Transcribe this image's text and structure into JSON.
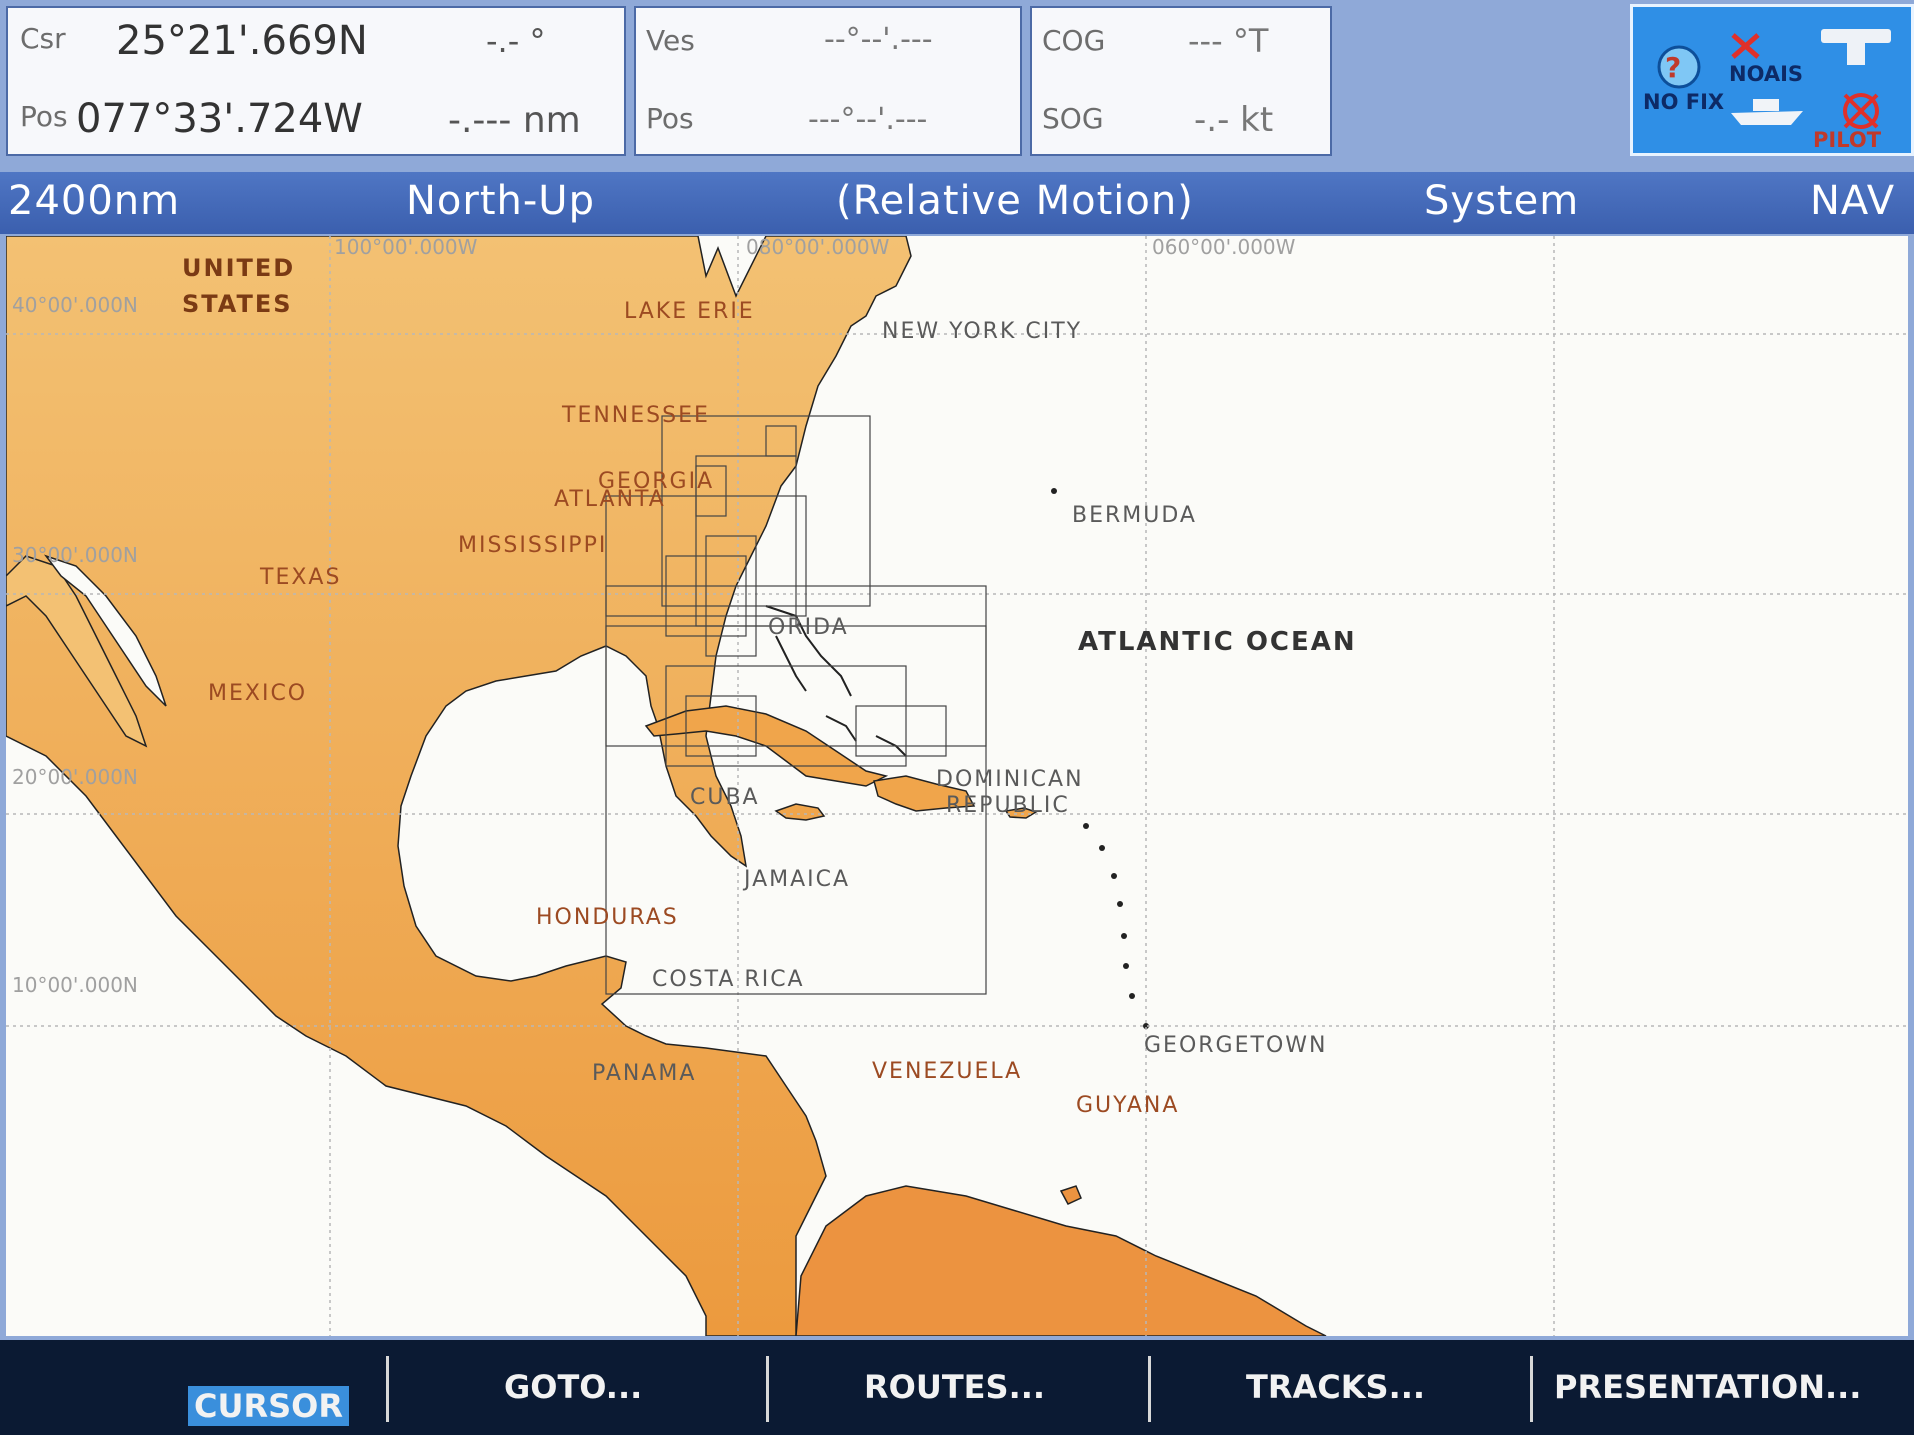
{
  "cursor_panel": {
    "lbl_csr": "Csr",
    "lat": "25°21'.669N",
    "bearing": "-.- °",
    "lbl_pos": "Pos",
    "lon": "077°33'.724W",
    "range": "-.--- nm"
  },
  "vessel_panel": {
    "lbl_ves": "Ves",
    "lat": "--°--'.---",
    "lbl_pos": "Pos",
    "lon": "---°--'.---"
  },
  "course_panel": {
    "lbl_cog": "COG",
    "cog": "--- °T",
    "lbl_sog": "SOG",
    "sog": "-.- kt"
  },
  "status": {
    "no_fix": "NO FIX",
    "no_ais": "NOAIS",
    "pilot": "PILOT"
  },
  "header": {
    "range": "2400nm",
    "orientation": "North-Up",
    "motion": "(Relative Motion)",
    "mode": "System",
    "nav": "NAV"
  },
  "map": {
    "grid": {
      "lon1": "100°00'.000W",
      "lon2": "080°00'.000W",
      "lon3": "060°00'.000W",
      "lat40": "40°00'.000N",
      "lat30": "30°00'.000N",
      "lat20": "20°00'.000N",
      "lat10": "10°00'.000N"
    },
    "labels": {
      "united": "UNITED",
      "states": "STATES",
      "lake_erie": "LAKE ERIE",
      "nyc": "NEW YORK CITY",
      "tennessee": "TENNESSEE",
      "georgia": "GEORGIA",
      "atlanta": "ATLANTA",
      "mississippi": "MISSISSIPPI",
      "texas": "TEXAS",
      "bermuda": "BERMUDA",
      "florida": "ORIDA",
      "atlantic": "ATLANTIC OCEAN",
      "mexico": "MEXICO",
      "cuba": "CUBA",
      "dominican": "DOMINICAN",
      "republic": "REPUBLIC",
      "jamaica": "JAMAICA",
      "honduras": "HONDURAS",
      "costa_rica": "COSTA RICA",
      "georgetown": "GEORGETOWN",
      "venezuela": "VENEZUELA",
      "guyana": "GUYANA",
      "panama": "PANAMA"
    },
    "colors": {
      "land_north": "#efb466",
      "land_south": "#ec9a3e",
      "sea": "#fbfbf8",
      "label": "#9c4a22",
      "label_sea": "#5a5a5a"
    }
  },
  "softkeys": {
    "cursor": "CURSOR",
    "goto": "GOTO...",
    "routes": "ROUTES...",
    "tracks": "TRACKS...",
    "presentation": "PRESENTATION..."
  }
}
